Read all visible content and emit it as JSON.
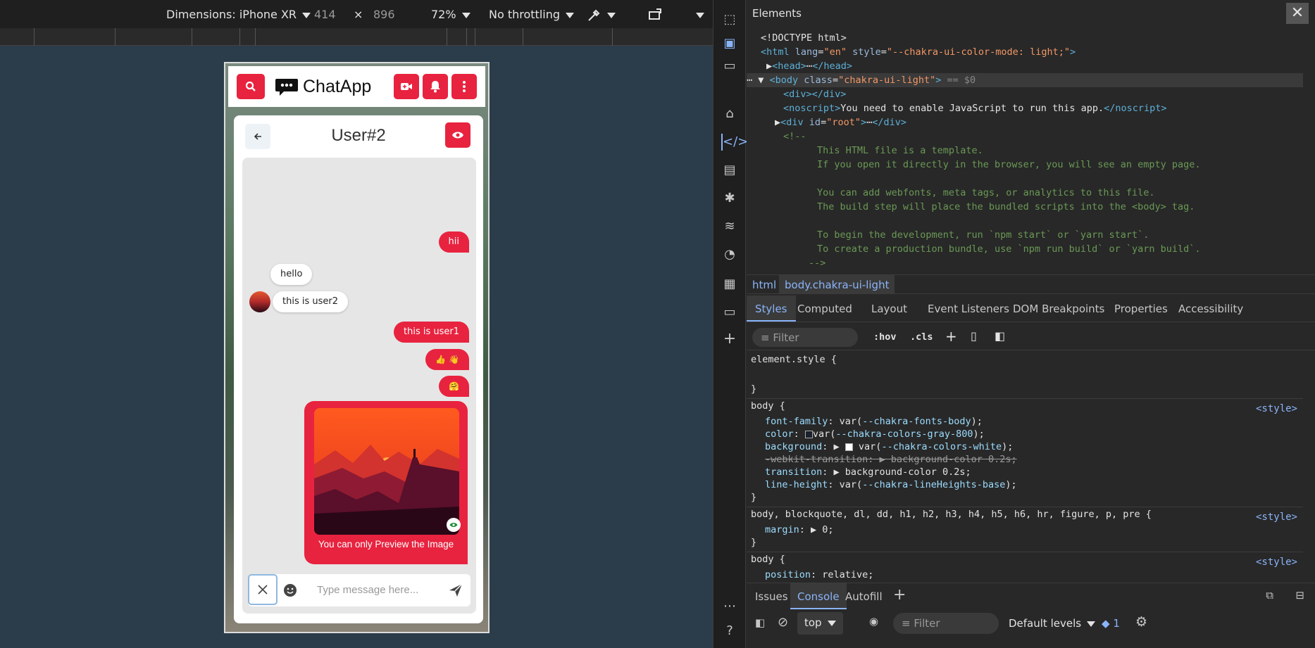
{
  "device_toolbar": {
    "dimensions": "Dimensions: iPhone XR",
    "width": "414",
    "times": "×",
    "height": "896",
    "zoom": "72%",
    "throttling": "No throttling"
  },
  "app": {
    "name": "ChatApp",
    "accent": "#e8233f",
    "chat_user": "User#2",
    "messages": [
      {
        "from": "me",
        "text": "hii"
      },
      {
        "from": "them",
        "text": "hello"
      },
      {
        "from": "them",
        "text": "this is user2"
      },
      {
        "from": "me",
        "text": "this is user1"
      },
      {
        "from": "me",
        "text": "👍 👋"
      },
      {
        "from": "me",
        "text": "🤗"
      }
    ],
    "image_caption": "You can only Preview the Image",
    "input_placeholder": "Type message here..."
  },
  "devtools": {
    "panel_title": "Elements",
    "dom_lines": [
      "<!DOCTYPE html>",
      "This HTML file is a template.",
      "If you open it directly in the browser, you will see an empty page.",
      "You can add webfonts, meta tags, or analytics to this file.",
      "The build step will place the bundled scripts into the <body> tag.",
      "To begin the development, run `npm start` or `yarn start`.",
      "To create a production bundle, use `npm run build` or `yarn build`."
    ],
    "noscript_text": "You need to enable JavaScript to run this app.",
    "breadcrumbs": [
      "html",
      "body.chakra-ui-light"
    ],
    "style_tabs": [
      "Styles",
      "Computed",
      "Layout",
      "Event Listeners",
      "DOM Breakpoints",
      "Properties",
      "Accessibility"
    ],
    "filter_placeholder": "Filter",
    "hov": ":hov",
    "cls": ".cls",
    "rules": {
      "element_style": "element.style {",
      "body_sel": "body {",
      "src": "<style>",
      "margin_sel": "body, blockquote, dl, dd, h1, h2, h3, h4, h5, h6, hr, figure, p, pre {",
      "body2_sel": "body {"
    },
    "drawer_tabs": [
      "Issues",
      "Console",
      "Autofill"
    ],
    "console": {
      "context": "top",
      "filter": "Filter",
      "levels": "Default levels",
      "issues_count": "1"
    }
  }
}
